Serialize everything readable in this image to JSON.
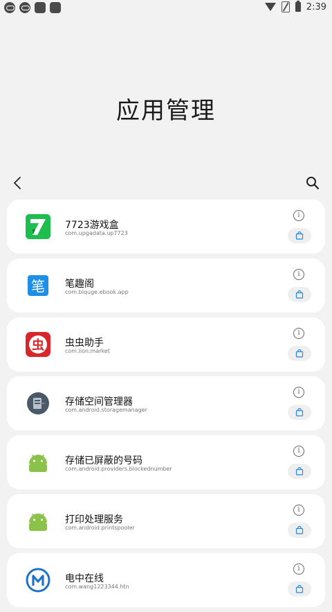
{
  "status_bar": {
    "time": "2:39"
  },
  "page": {
    "title": "应用管理"
  },
  "apps": [
    {
      "name": "7723游戏盒",
      "package": "com.upgadata.up7723",
      "icon": "7723-app-icon",
      "color": "#1dbd4f"
    },
    {
      "name": "笔趣阁",
      "package": "com.biquge.ebook.app",
      "icon": "biquge-app-icon",
      "color": "#1e8fe8"
    },
    {
      "name": "虫虫助手",
      "package": "com.lion.market",
      "icon": "chongchong-app-icon",
      "color": "#d9262b"
    },
    {
      "name": "存储空间管理器",
      "package": "com.android.storagemanager",
      "icon": "storage-app-icon",
      "color": "#4b5867"
    },
    {
      "name": "存储已屏蔽的号码",
      "package": "com.android.providers.blockednumber",
      "icon": "android-app-icon",
      "color": "#8bc34a"
    },
    {
      "name": "打印处理服务",
      "package": "com.android.printspooler",
      "icon": "android-app-icon",
      "color": "#8bc34a"
    },
    {
      "name": "电中在线",
      "package": "com.wang1223344.htn",
      "icon": "dianzhong-app-icon",
      "color": "#1e73c9"
    }
  ]
}
